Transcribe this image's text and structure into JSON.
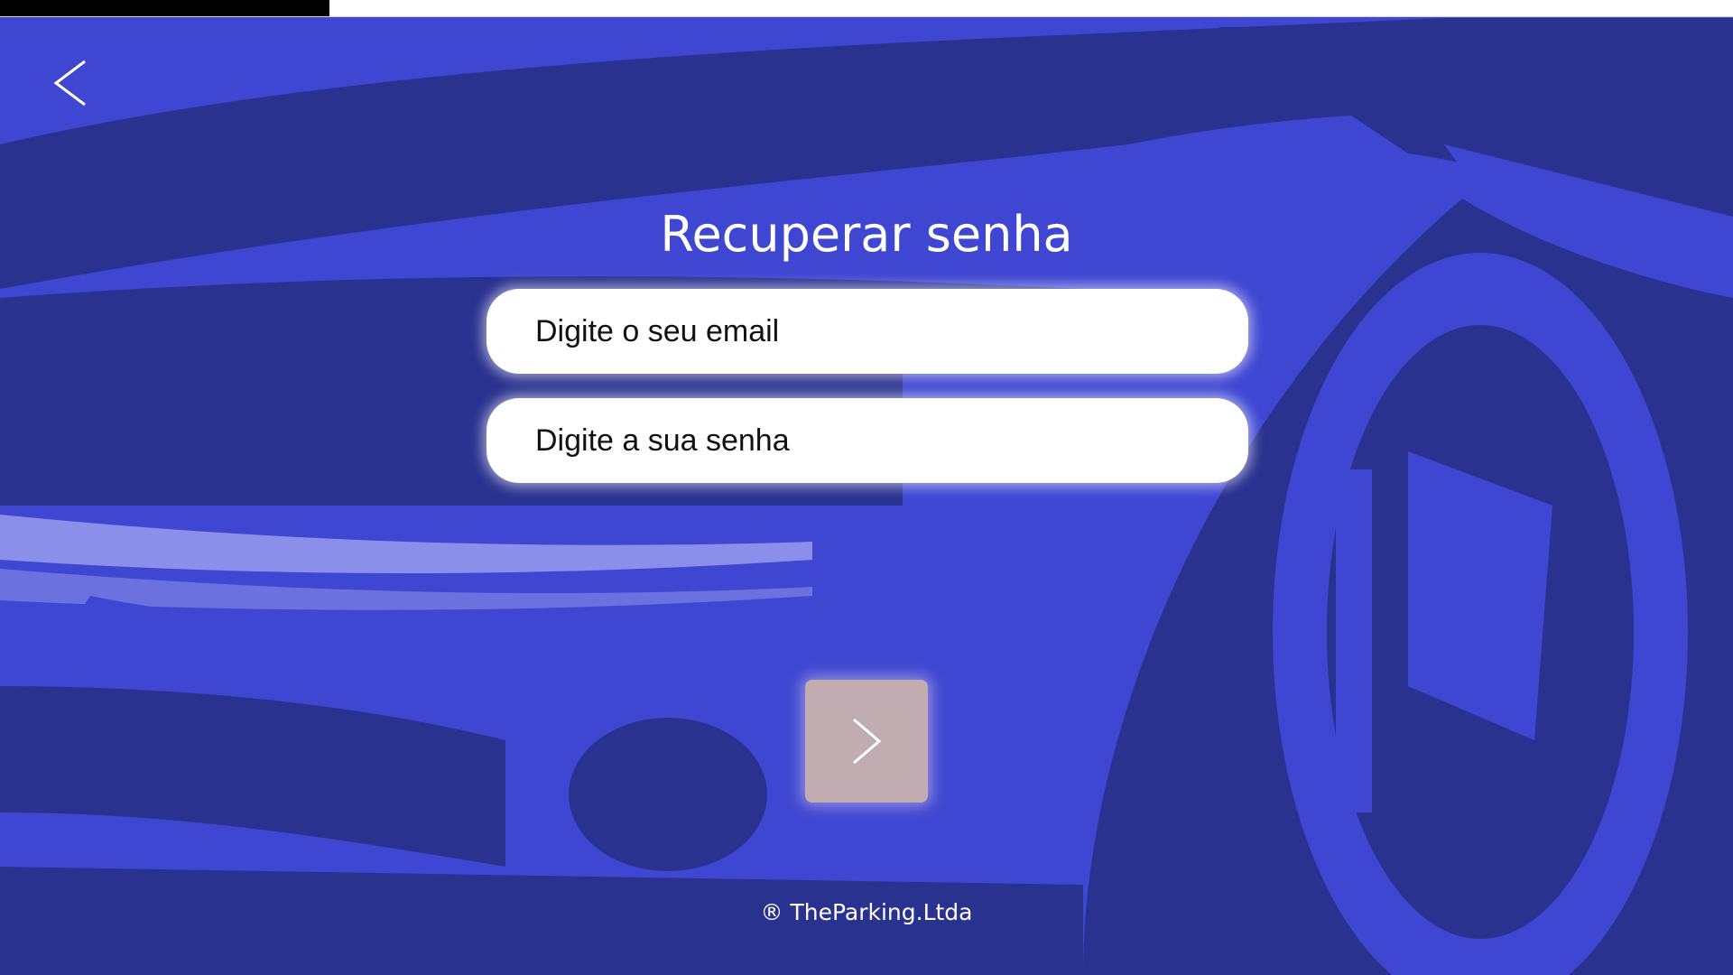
{
  "progress": {
    "fraction": 0.19
  },
  "header": {
    "back_icon": "chevron-left-icon"
  },
  "form": {
    "title": "Recuperar senha",
    "email_placeholder": "Digite o seu email",
    "password_placeholder": "Digite a sua senha",
    "next_icon": "chevron-right-icon"
  },
  "footer": {
    "text": "® TheParking.Ltda"
  },
  "colors": {
    "background": "#3f47d2",
    "background_dark": "#2a3290",
    "button": "#c1adb1"
  }
}
